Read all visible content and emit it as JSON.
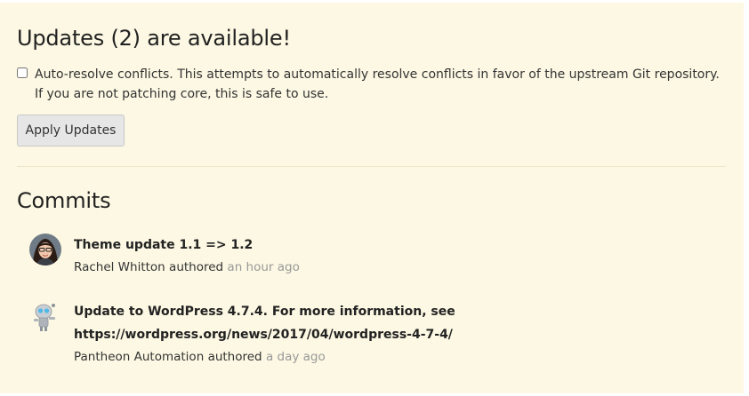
{
  "updates": {
    "title": "Updates (2) are available!",
    "auto_resolve_checked": false,
    "auto_resolve_label": "Auto-resolve conflicts. This attempts to automatically resolve conflicts in favor of the upstream Git repository. If you are not patching core, this is safe to use.",
    "apply_button_label": "Apply Updates"
  },
  "commits": {
    "title": "Commits",
    "items": [
      {
        "message": "Theme update 1.1 => 1.2",
        "author": "Rachel Whitton",
        "authored_word": "authored",
        "time": "an hour ago"
      },
      {
        "message": "Update to WordPress 4.7.4. For more information, see https://wordpress.org/news/2017/04/wordpress-4-7-4/",
        "author": "Pantheon Automation",
        "authored_word": "authored",
        "time": "a day ago"
      }
    ]
  },
  "colors": {
    "panel_background": "#fcf8e3",
    "timestamp": "#999999",
    "button_background": "#e6e6e6"
  }
}
